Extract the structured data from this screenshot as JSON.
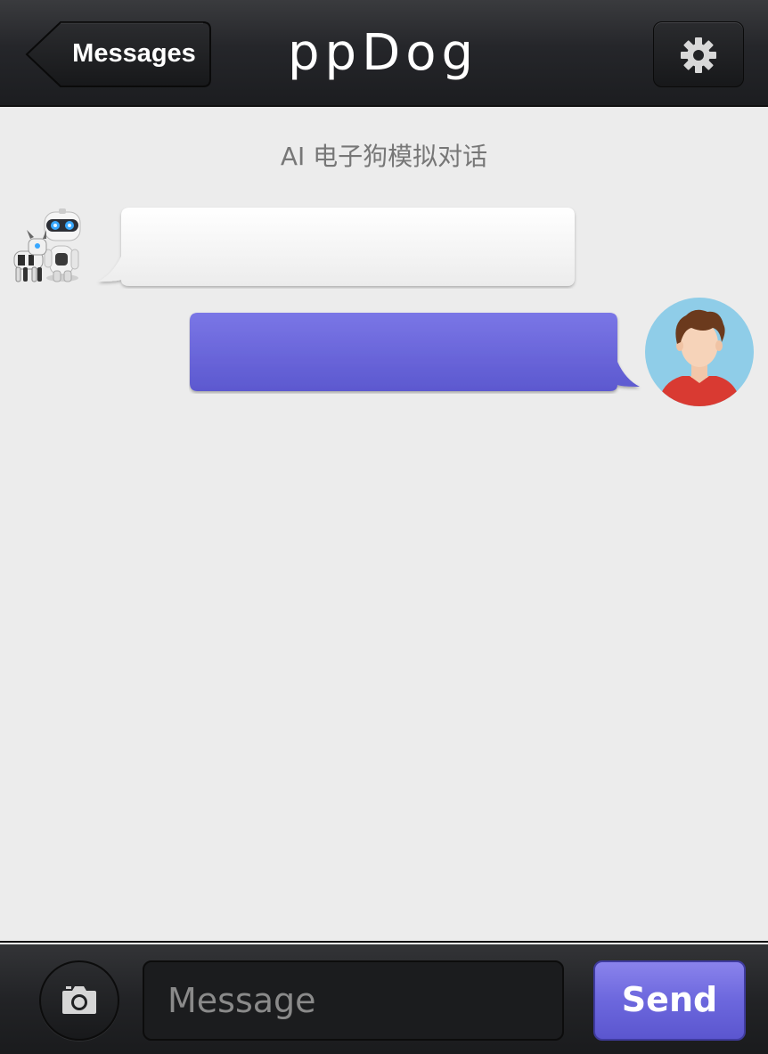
{
  "header": {
    "back_label": "Messages",
    "title": "ppDog",
    "settings_icon": "gear-icon"
  },
  "chat": {
    "subtitle": "AI 电子狗模拟对话",
    "messages": [
      {
        "sender": "bot",
        "avatar": "robot-dog-avatar",
        "text": "",
        "bubble_color": "#f4f4f4"
      },
      {
        "sender": "user",
        "avatar": "user-avatar",
        "text": "",
        "bubble_color": "#6b68dd"
      }
    ]
  },
  "composer": {
    "camera_icon": "camera-icon",
    "placeholder": "Message",
    "send_label": "Send"
  },
  "colors": {
    "accent": "#6b68dd",
    "header_bg": "#25262a",
    "chat_bg": "#ececec"
  }
}
